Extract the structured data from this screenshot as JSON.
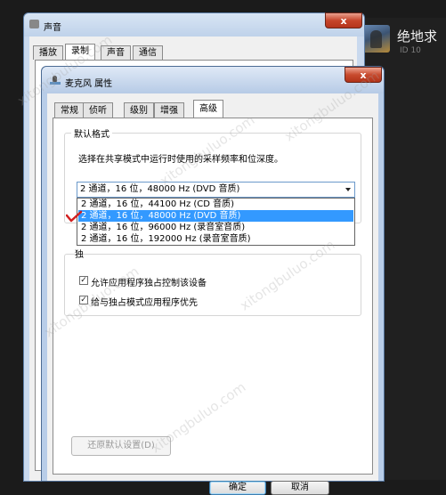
{
  "right_panel": {
    "game_title": "绝地求",
    "game_id": "ID 10",
    "thumbnail_icon": "game-thumbnail-icon"
  },
  "sound_window": {
    "title": "声音",
    "close_glyph": "x",
    "tabs": [
      "播放",
      "录制",
      "声音",
      "通信"
    ],
    "active_tab_index": 1
  },
  "mic_window": {
    "title": "麦克风 属性",
    "close_glyph": "x",
    "tabs": [
      "常规",
      "侦听",
      "级别",
      "增强",
      "高级"
    ],
    "active_tab_index": 4,
    "default_format": {
      "group_label": "默认格式",
      "description": "选择在共享模式中运行时使用的采样频率和位深度。",
      "selected_value": "2 通道，16 位，48000 Hz (DVD 音质)",
      "options": [
        "2 通道，16 位，44100 Hz (CD 音质)",
        "2 通道，16 位，48000 Hz (DVD 音质)",
        "2 通道，16 位，96000 Hz (录音室音质)",
        "2 通道，16 位，192000 Hz (录音室音质)"
      ],
      "highlighted_index": 1
    },
    "exclusive": {
      "group_label_fragment": "独",
      "allow_exclusive_label": "允许应用程序独占控制该设备",
      "allow_exclusive_checked": true,
      "priority_label": "给与独占模式应用程序优先",
      "priority_checked": true
    },
    "restore_default_label": "还原默认设置(D)",
    "ok_label": "确定",
    "cancel_label": "取消"
  },
  "annotation_color": "#d21f1f"
}
